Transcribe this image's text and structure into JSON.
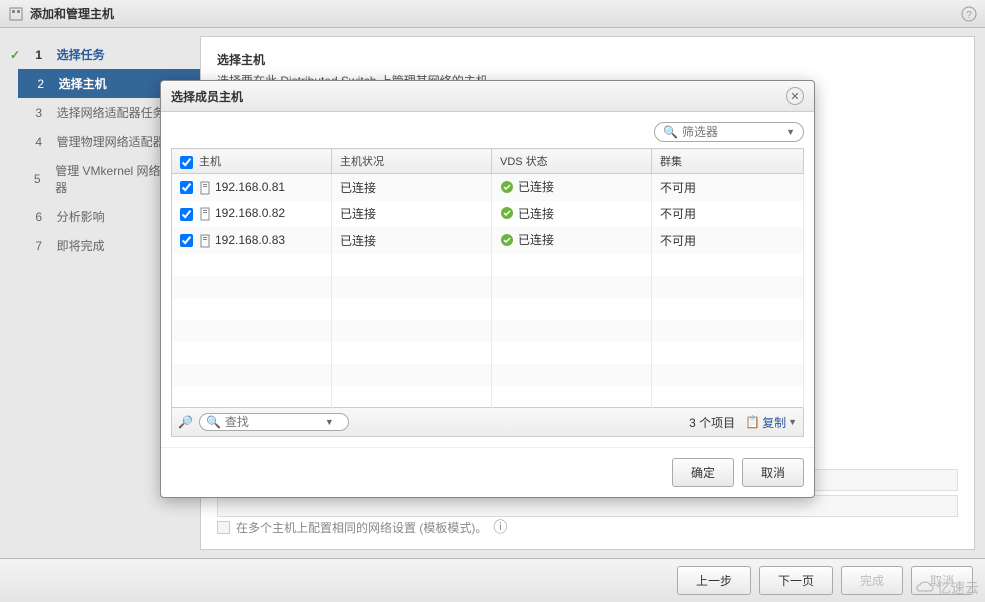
{
  "titlebar": {
    "title": "添加和管理主机"
  },
  "sidebar": {
    "steps": [
      {
        "num": "1",
        "label": "选择任务",
        "completed": true
      },
      {
        "num": "2",
        "label": "选择主机",
        "active": true
      },
      {
        "num": "3",
        "label": "选择网络适配器任务"
      },
      {
        "num": "4",
        "label": "管理物理网络适配器"
      },
      {
        "num": "5",
        "label": "管理 VMkernel 网络适配器"
      },
      {
        "num": "6",
        "label": "分析影响"
      },
      {
        "num": "7",
        "label": "即将完成"
      }
    ]
  },
  "content": {
    "title": "选择主机",
    "desc": "选择要在此 Distributed Switch 上管理其网络的主机。",
    "template_label": "在多个主机上配置相同的网络设置 (模板模式)。"
  },
  "modal": {
    "title": "选择成员主机",
    "filter_placeholder": "筛选器",
    "search_placeholder": "查找",
    "columns": {
      "host": "主机",
      "host_status": "主机状况",
      "vds_status": "VDS 状态",
      "cluster": "群集"
    },
    "rows": [
      {
        "checked": true,
        "ip": "192.168.0.81",
        "host_status": "已连接",
        "vds_status": "已连接",
        "cluster": "不可用"
      },
      {
        "checked": true,
        "ip": "192.168.0.82",
        "host_status": "已连接",
        "vds_status": "已连接",
        "cluster": "不可用"
      },
      {
        "checked": true,
        "ip": "192.168.0.83",
        "host_status": "已连接",
        "vds_status": "已连接",
        "cluster": "不可用"
      }
    ],
    "item_count": "3 个项目",
    "copy_label": "复制",
    "ok": "确定",
    "cancel": "取消"
  },
  "footer": {
    "back": "上一步",
    "next": "下一页",
    "finish": "完成",
    "cancel": "取消"
  },
  "watermark": "亿速云"
}
